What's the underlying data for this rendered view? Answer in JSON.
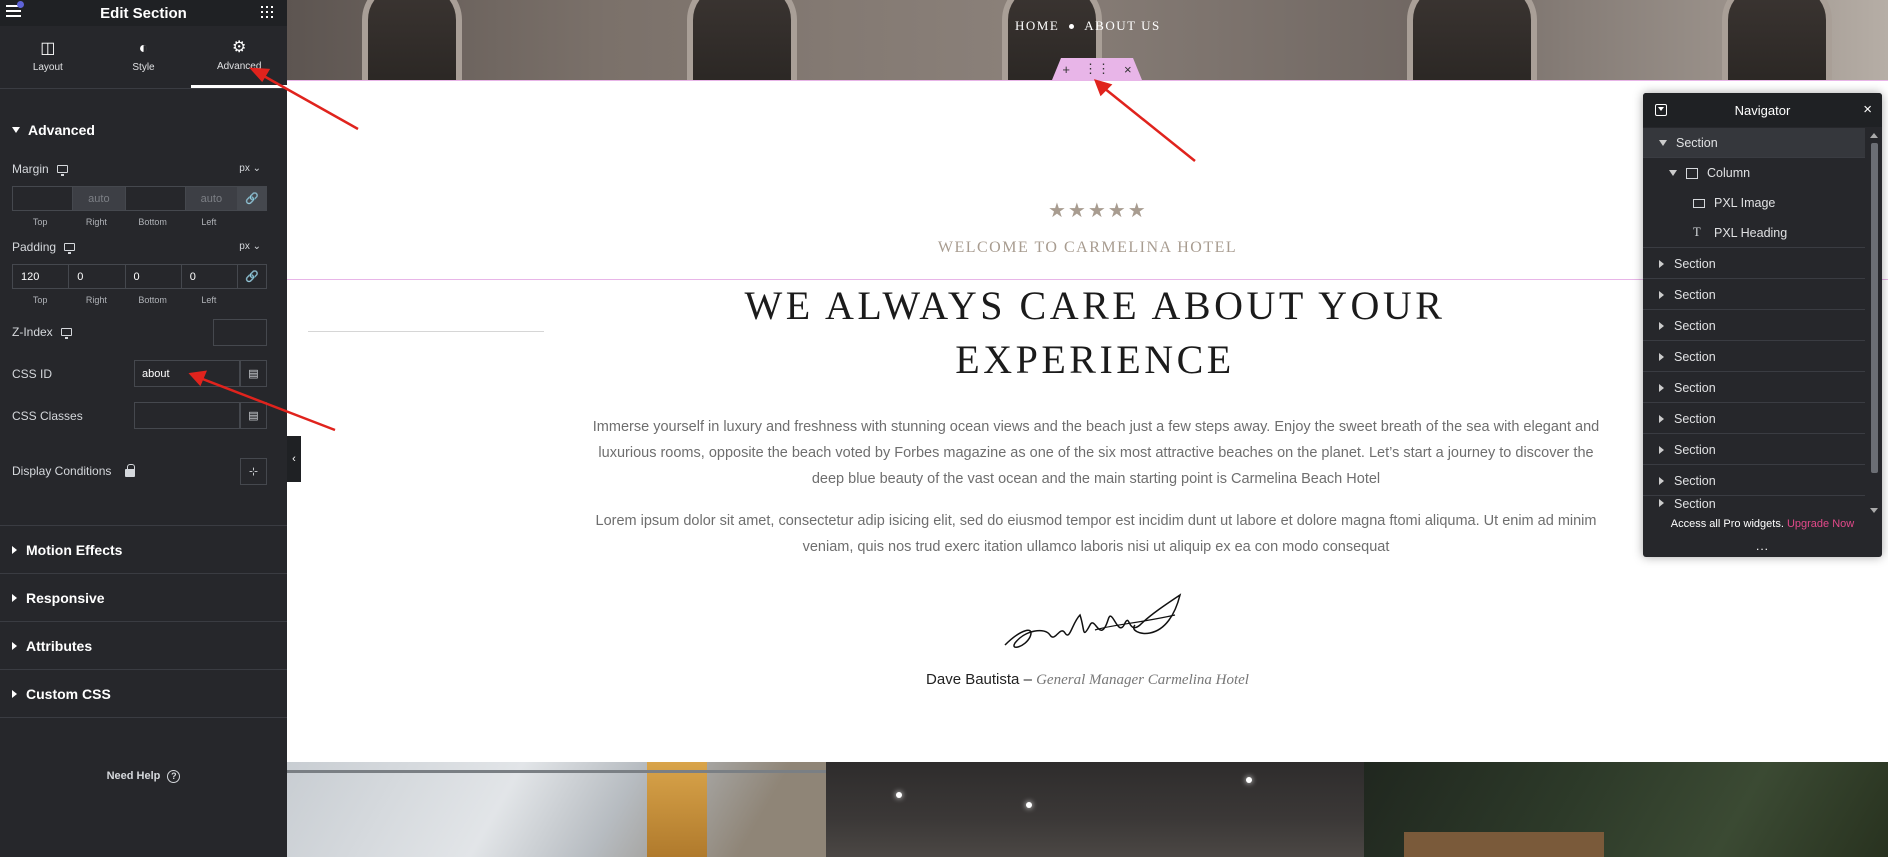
{
  "panel": {
    "title": "Edit Section",
    "tabs": [
      {
        "label": "Layout",
        "icon": "layout-icon"
      },
      {
        "label": "Style",
        "icon": "style-icon"
      },
      {
        "label": "Advanced",
        "icon": "gear-icon"
      }
    ],
    "advanced_section": "Advanced",
    "margin": {
      "label": "Margin",
      "unit": "px",
      "values": [
        "",
        "auto",
        "",
        "auto"
      ],
      "sides": [
        "Top",
        "Right",
        "Bottom",
        "Left"
      ]
    },
    "padding": {
      "label": "Padding",
      "unit": "px",
      "values": [
        "120",
        "0",
        "0",
        "0"
      ],
      "sides": [
        "Top",
        "Right",
        "Bottom",
        "Left"
      ]
    },
    "zindex_label": "Z-Index",
    "css_id_label": "CSS ID",
    "css_id_value": "about",
    "css_classes_label": "CSS Classes",
    "display_conditions_label": "Display Conditions",
    "collapsed_sections": [
      "Motion Effects",
      "Responsive",
      "Attributes",
      "Custom CSS"
    ],
    "need_help": "Need Help"
  },
  "hero": {
    "menu": [
      "HOME",
      "ABOUT US"
    ],
    "handle_buttons": [
      "+",
      "⋮⋮",
      "×"
    ]
  },
  "content": {
    "stars": "★★★★★",
    "rating": 5,
    "welcome": "WELCOME TO CARMELINA HOTEL",
    "heading_line1": "WE ALWAYS CARE ABOUT YOUR",
    "heading_line2": "EXPERIENCE",
    "para1": "Immerse yourself in luxury and freshness with stunning ocean views and the beach just a few steps away. Enjoy the sweet breath of the sea with elegant and luxurious rooms, opposite the beach voted by Forbes magazine as one of the six most attractive beaches on the planet. Let’s start a journey to discover the deep blue beauty of the vast ocean and the main starting point is Carmelina Beach Hotel",
    "para2": "Lorem ipsum dolor sit amet, consectetur adip isicing elit, sed do eiusmod tempor est incidim dunt ut labore et dolore magna ftomi aliquma. Ut enim ad minim veniam, quis nos trud exerc itation ullamco laboris nisi ut aliquip ex ea con modo consequat",
    "byline_name": "Dave Bautista –",
    "byline_role": "General Manager Carmelina Hotel"
  },
  "navigator": {
    "title": "Navigator",
    "items": [
      {
        "label": "Section"
      },
      {
        "label": "Column"
      },
      {
        "label": "PXL Image"
      },
      {
        "label": "PXL Heading"
      },
      {
        "label": "Section"
      },
      {
        "label": "Section"
      },
      {
        "label": "Section"
      },
      {
        "label": "Section"
      },
      {
        "label": "Section"
      },
      {
        "label": "Section"
      },
      {
        "label": "Section"
      },
      {
        "label": "Section"
      },
      {
        "label": "Section"
      }
    ],
    "footer_text": "Access all Pro widgets.",
    "footer_link": "Upgrade Now",
    "more": "..."
  },
  "colors": {
    "panel_bg": "#26272b",
    "accent_pink": "#e8b5e8",
    "annotation_red": "#e0231d",
    "upgrade_link": "#e2498a",
    "star_color": "#a89c90"
  }
}
